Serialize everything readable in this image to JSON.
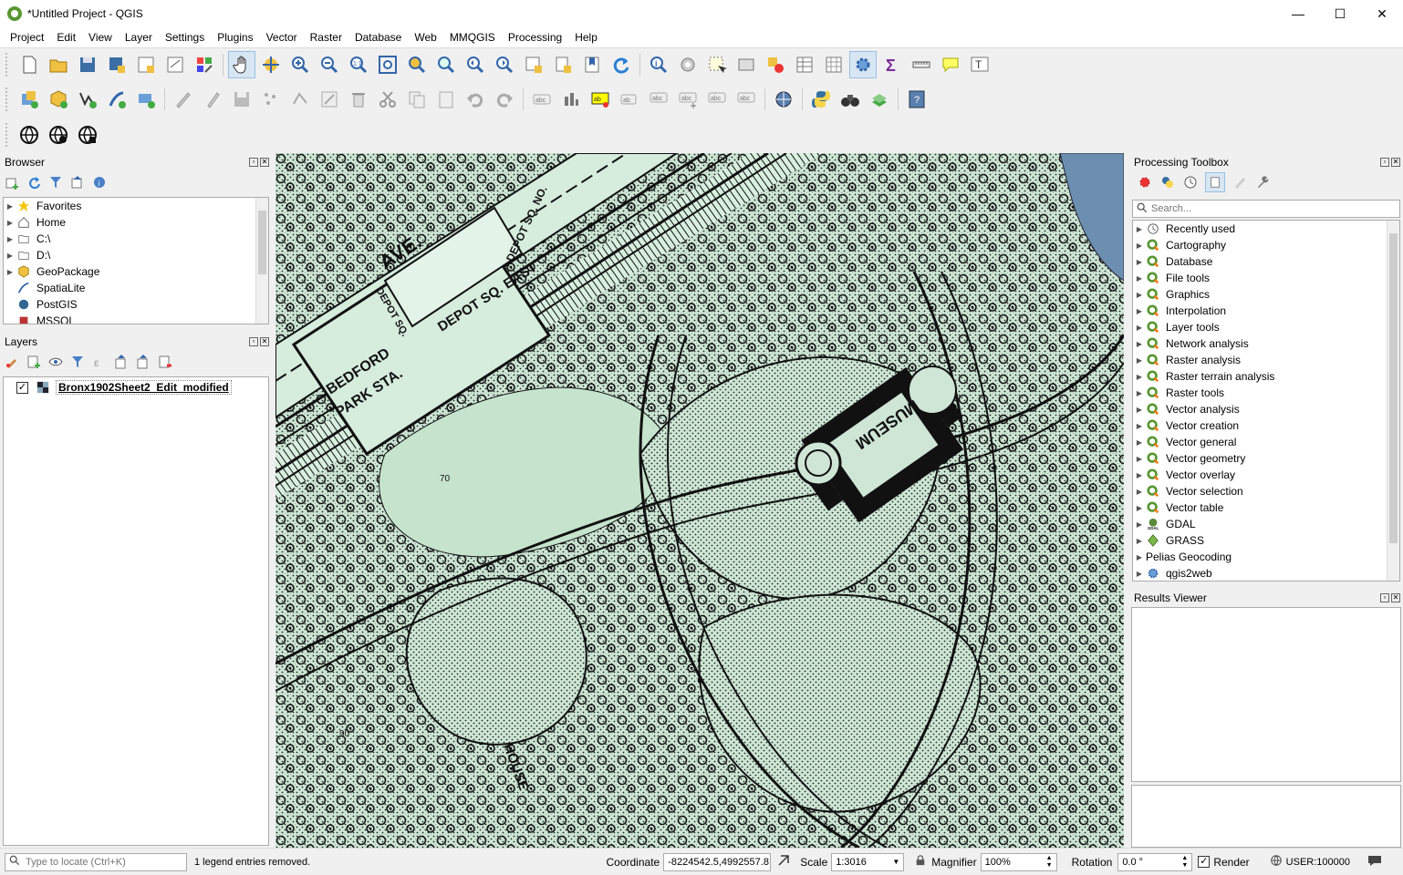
{
  "window": {
    "title": "*Untitled Project - QGIS",
    "minimize": "—",
    "maximize": "☐",
    "close": "✕"
  },
  "menu": [
    "Project",
    "Edit",
    "View",
    "Layer",
    "Settings",
    "Plugins",
    "Vector",
    "Raster",
    "Database",
    "Web",
    "MMQGIS",
    "Processing",
    "Help"
  ],
  "browser": {
    "title": "Browser",
    "items": [
      {
        "label": "Favorites",
        "icon": "star-icon",
        "expandable": true
      },
      {
        "label": "Home",
        "icon": "home-icon",
        "expandable": true
      },
      {
        "label": "C:\\",
        "icon": "drive-icon",
        "expandable": true
      },
      {
        "label": "D:\\",
        "icon": "drive-icon",
        "expandable": true
      },
      {
        "label": "GeoPackage",
        "icon": "geopackage-icon",
        "expandable": true
      },
      {
        "label": "SpatiaLite",
        "icon": "spatialite-icon",
        "expandable": false
      },
      {
        "label": "PostGIS",
        "icon": "postgis-icon",
        "expandable": false
      },
      {
        "label": "MSSQL",
        "icon": "mssql-icon",
        "expandable": false
      }
    ]
  },
  "layers": {
    "title": "Layers",
    "items": [
      {
        "label": "Bronx1902Sheet2_Edit_modified",
        "checked": true
      }
    ]
  },
  "toolbox": {
    "title": "Processing Toolbox",
    "search_placeholder": "Search...",
    "items": [
      {
        "label": "Recently used",
        "icon": "clock-icon"
      },
      {
        "label": "Cartography",
        "icon": "qgis-icon"
      },
      {
        "label": "Database",
        "icon": "qgis-icon"
      },
      {
        "label": "File tools",
        "icon": "qgis-icon"
      },
      {
        "label": "Graphics",
        "icon": "qgis-icon"
      },
      {
        "label": "Interpolation",
        "icon": "qgis-icon"
      },
      {
        "label": "Layer tools",
        "icon": "qgis-icon"
      },
      {
        "label": "Network analysis",
        "icon": "qgis-icon"
      },
      {
        "label": "Raster analysis",
        "icon": "qgis-icon"
      },
      {
        "label": "Raster terrain analysis",
        "icon": "qgis-icon"
      },
      {
        "label": "Raster tools",
        "icon": "qgis-icon"
      },
      {
        "label": "Vector analysis",
        "icon": "qgis-icon"
      },
      {
        "label": "Vector creation",
        "icon": "qgis-icon"
      },
      {
        "label": "Vector general",
        "icon": "qgis-icon"
      },
      {
        "label": "Vector geometry",
        "icon": "qgis-icon"
      },
      {
        "label": "Vector overlay",
        "icon": "qgis-icon"
      },
      {
        "label": "Vector selection",
        "icon": "qgis-icon"
      },
      {
        "label": "Vector table",
        "icon": "qgis-icon"
      },
      {
        "label": "GDAL",
        "icon": "gdal-icon"
      },
      {
        "label": "GRASS",
        "icon": "grass-icon"
      },
      {
        "label": "Pelias Geocoding",
        "icon": ""
      },
      {
        "label": "qgis2web",
        "icon": "gear-icon"
      }
    ]
  },
  "results": {
    "title": "Results Viewer"
  },
  "map": {
    "labels": [
      "AVE.",
      "DEPOT SQ. EAST",
      "DEPOT SQ. NO.",
      "DEPOT SQ.",
      "BEDFORD",
      "PARK STA.",
      "MUSEUM",
      "HOUSE",
      "70",
      "90"
    ]
  },
  "status": {
    "locate_placeholder": "Type to locate (Ctrl+K)",
    "message": "1 legend entries removed.",
    "coordinate_label": "Coordinate",
    "coordinate": "-8224542.5,4992557.8",
    "scale_label": "Scale",
    "scale": "1:3016",
    "magnifier_label": "Magnifier",
    "magnifier": "100%",
    "rotation_label": "Rotation",
    "rotation": "0.0 °",
    "render_label": "Render",
    "crs": "USER:100000"
  }
}
